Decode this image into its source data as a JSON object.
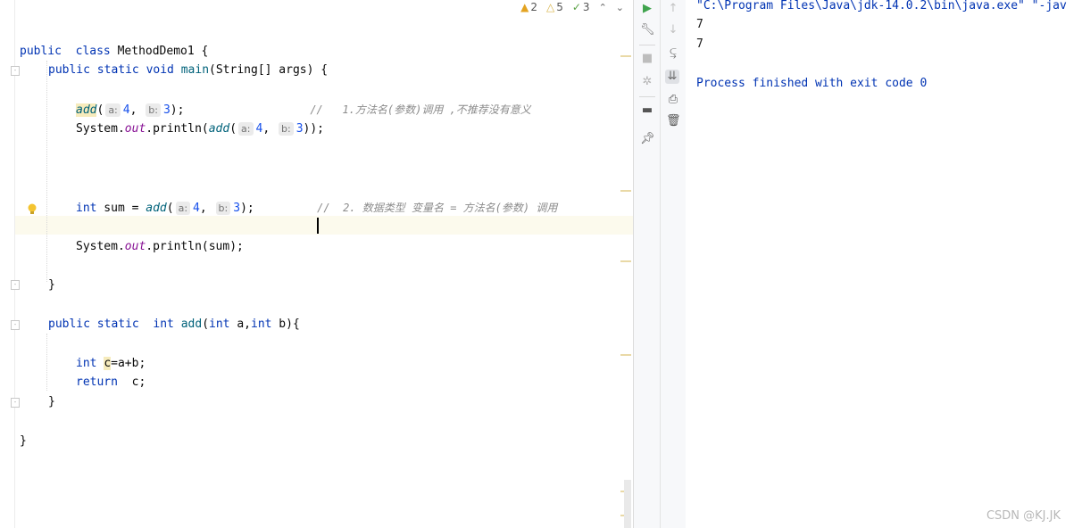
{
  "inspections": {
    "warnings": "2",
    "weak_warnings": "5",
    "typos": "3"
  },
  "code": {
    "l1": {
      "kw1": "public",
      "kw2": "class",
      "name": "MethodDemo1 {"
    },
    "l2": {
      "kw": "public static void",
      "fn": "main",
      "rest": "(String[] args) {"
    },
    "l3": {
      "fn": "add",
      "open": "(",
      "hint_a": "a:",
      "a": "4",
      "comma": ",",
      "hint_b": "b:",
      "b": "3",
      "close": ");",
      "comment": "//   1.方法名(参数)调用 ,不推荐没有意义"
    },
    "l4": {
      "pre": "System.",
      "out": "out",
      "mid": ".println(",
      "fn": "add",
      "open": "(",
      "hint_a": "a:",
      "a": "4",
      "comma": ",",
      "hint_b": "b:",
      "b": "3",
      "close": "));"
    },
    "l5": {
      "kw": "int",
      "var": " sum = ",
      "fn": "add",
      "open": "(",
      "hint_a": "a:",
      "a": "4",
      "comma": ",",
      "hint_b": "b:",
      "b": "3",
      "close": ");",
      "comment": "//  2. 数据类型 变量名 = 方法名(参数) 调用"
    },
    "l6": {
      "pre": "System.",
      "out": "out",
      "rest": ".println(sum);"
    },
    "l7": {
      "text": "}"
    },
    "l8": {
      "kw": "public static",
      "kw2": "int",
      "fn": "add",
      "open": "(",
      "kw3": "int",
      "a": " a,",
      "kw4": "int",
      "rest": " b){"
    },
    "l9": {
      "kw": "int",
      "var": "c",
      "rest": "=a+b;"
    },
    "l10": {
      "kw": "return",
      "rest": "  c;"
    },
    "l11": {
      "text": "}"
    },
    "l12": {
      "text": "}"
    }
  },
  "console": {
    "command": "\"C:\\Program Files\\Java\\jdk-14.0.2\\bin\\java.exe\" \"-jav",
    "output1": "7",
    "output2": "7",
    "exit": "Process finished with exit code 0"
  },
  "watermark": "CSDN @KJ.JK",
  "icons": {
    "run": "run-icon",
    "wrench": "wrench-icon",
    "stop": "stop-icon",
    "debug": "bug-icon",
    "layout": "layout-icon",
    "pin": "pin-icon",
    "up": "arrow-up-icon",
    "down": "arrow-down-icon",
    "wrap": "soft-wrap-icon",
    "scroll_end": "scroll-to-end-icon",
    "print": "print-icon",
    "trash": "trash-icon"
  },
  "colors": {
    "keyword": "#0033b3",
    "function": "#00627a",
    "static_field": "#871094",
    "number": "#1750eb",
    "comment": "#8c8c8c",
    "run_green": "#3fa34d"
  }
}
